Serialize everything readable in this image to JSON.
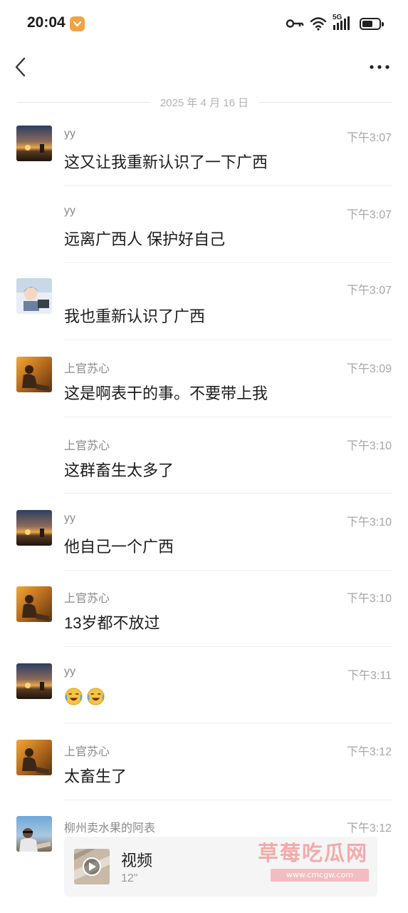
{
  "status_bar": {
    "time": "20:04",
    "network": "5G",
    "icons": [
      "app-badge-icon",
      "key-icon",
      "wifi-icon",
      "signal-icon",
      "battery-icon"
    ]
  },
  "header": {
    "back_icon": "chevron-left-icon",
    "more_icon": "more-dots-icon"
  },
  "date_separator": "2025 年 4 月 16 日",
  "messages": [
    {
      "name": "yy",
      "time": "下午3:07",
      "text": "这又让我重新认识了一下广西",
      "avatar": "sunset"
    },
    {
      "name": "yy",
      "time": "下午3:07",
      "text": "远离广西人 保护好自己",
      "avatar": ""
    },
    {
      "name": "",
      "time": "下午3:07",
      "text": "我也重新认识了广西",
      "avatar": "cartoon"
    },
    {
      "name": "上官苏心",
      "time": "下午3:09",
      "text": "这是啊表干的事。不要带上我",
      "avatar": "autumn"
    },
    {
      "name": "上官苏心",
      "time": "下午3:10",
      "text": "这群畜生太多了",
      "avatar": ""
    },
    {
      "name": "yy",
      "time": "下午3:10",
      "text": "他自己一个广西",
      "avatar": "sunset"
    },
    {
      "name": "上官苏心",
      "time": "下午3:10",
      "text": "13岁都不放过",
      "avatar": "autumn"
    },
    {
      "name": "yy",
      "time": "下午3:11",
      "text": "",
      "emojis": [
        "laughing-crying-emoji",
        "laughing-crying-emoji"
      ],
      "avatar": "sunset"
    },
    {
      "name": "上官苏心",
      "time": "下午3:12",
      "text": "太畜生了",
      "avatar": "autumn"
    },
    {
      "name": "柳州卖水果的阿表",
      "time": "下午3:12",
      "avatar": "man",
      "attachment": {
        "type": "video",
        "label": "视频",
        "duration": "12\""
      }
    }
  ],
  "watermark": {
    "title": "草莓吃瓜网",
    "url": "www.cmcgw.com"
  },
  "colors": {
    "background": "#ffffff",
    "name_text": "#8a8a8a",
    "time_text": "#a6a6a6",
    "watermark": "#f29696"
  }
}
